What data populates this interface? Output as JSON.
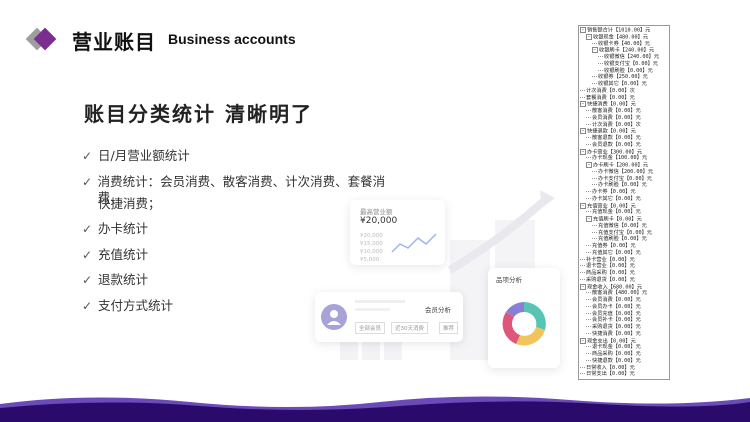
{
  "header": {
    "title_cn": "营业账目",
    "title_en": "Business accounts"
  },
  "headline": "账目分类统计  清晰明了",
  "features": [
    "日/月营业额统计",
    "消费统计：会员消费、散客消费、计次消费、套餐消费、",
    "快捷消费；",
    "办卡统计",
    "充值统计",
    "退款统计",
    "支付方式统计"
  ],
  "illustration": {
    "revenue_card_title": "最高营业额",
    "revenue_value": "¥20,000",
    "product_card_title": "品项分析",
    "member_card_title": "会员分析",
    "member_filters": [
      "全部会员",
      "近30天消费",
      "推荐"
    ],
    "axis_labels": [
      "¥20,000",
      "¥15,000",
      "¥10,000",
      "¥5,000"
    ]
  },
  "tree": [
    {
      "level": 0,
      "toggle": "−",
      "text": "销售额合计【1010.00】元"
    },
    {
      "level": 1,
      "toggle": "−",
      "text": "收银现金【480.00】元"
    },
    {
      "level": 2,
      "toggle": "",
      "text": "收银卡券【40.00】元"
    },
    {
      "level": 2,
      "toggle": "−",
      "text": "收银刷卡【240.00】元"
    },
    {
      "level": 3,
      "toggle": "",
      "text": "收银微信【240.00】元"
    },
    {
      "level": 3,
      "toggle": "",
      "text": "收银支付宝【0.00】元"
    },
    {
      "level": 3,
      "toggle": "",
      "text": "收银刷脸【0.00】元"
    },
    {
      "level": 2,
      "toggle": "",
      "text": "收银券【250.00】元"
    },
    {
      "level": 2,
      "toggle": "",
      "text": "收银其它【0.00】元"
    },
    {
      "level": 0,
      "toggle": "",
      "text": "计次消费【0.00】次"
    },
    {
      "level": 0,
      "toggle": "",
      "text": "套餐消费【0.00】元"
    },
    {
      "level": 0,
      "toggle": "−",
      "text": "快捷消费【0.00】元"
    },
    {
      "level": 1,
      "toggle": "",
      "text": "散客消费【0.00】元"
    },
    {
      "level": 1,
      "toggle": "",
      "text": "会员消费【0.00】元"
    },
    {
      "level": 1,
      "toggle": "",
      "text": "计次消费【0.00】次"
    },
    {
      "level": 0,
      "toggle": "−",
      "text": "快捷退款【0.00】元"
    },
    {
      "level": 1,
      "toggle": "",
      "text": "散客退款【0.00】元"
    },
    {
      "level": 1,
      "toggle": "",
      "text": "会员退款【0.00】元"
    },
    {
      "level": 0,
      "toggle": "−",
      "text": "办卡营业【300.00】元"
    },
    {
      "level": 1,
      "toggle": "",
      "text": "办卡现金【100.00】元"
    },
    {
      "level": 1,
      "toggle": "−",
      "text": "办卡刷卡【200.00】元"
    },
    {
      "level": 2,
      "toggle": "",
      "text": "办卡微信【200.00】元"
    },
    {
      "level": 2,
      "toggle": "",
      "text": "办卡支付宝【0.00】元"
    },
    {
      "level": 2,
      "toggle": "",
      "text": "办卡刷脸【0.00】元"
    },
    {
      "level": 1,
      "toggle": "",
      "text": "办卡券【0.00】元"
    },
    {
      "level": 1,
      "toggle": "",
      "text": "办卡其它【0.00】元"
    },
    {
      "level": 0,
      "toggle": "−",
      "text": "充值营业【0.00】元"
    },
    {
      "level": 1,
      "toggle": "",
      "text": "充值现金【0.00】元"
    },
    {
      "level": 1,
      "toggle": "−",
      "text": "充值刷卡【0.00】元"
    },
    {
      "level": 2,
      "toggle": "",
      "text": "充值微信【0.00】元"
    },
    {
      "level": 2,
      "toggle": "",
      "text": "充值支付宝【0.00】元"
    },
    {
      "level": 2,
      "toggle": "",
      "text": "充值刷脸【0.00】元"
    },
    {
      "level": 1,
      "toggle": "",
      "text": "充值券【0.00】元"
    },
    {
      "level": 1,
      "toggle": "",
      "text": "充值其它【0.00】元"
    },
    {
      "level": 0,
      "toggle": "",
      "text": "补卡营业【0.00】元"
    },
    {
      "level": 0,
      "toggle": "",
      "text": "退卡营业【0.00】元"
    },
    {
      "level": 0,
      "toggle": "",
      "text": "商品采购【0.00】元"
    },
    {
      "level": 0,
      "toggle": "",
      "text": "采购退货【0.00】元"
    },
    {
      "level": 0,
      "toggle": "−",
      "text": "现金收入【680.00】元"
    },
    {
      "level": 1,
      "toggle": "",
      "text": "散客消费【480.00】元"
    },
    {
      "level": 1,
      "toggle": "",
      "text": "会员消费【0.00】元"
    },
    {
      "level": 1,
      "toggle": "",
      "text": "会员办卡【0.00】元"
    },
    {
      "level": 1,
      "toggle": "",
      "text": "会员充值【0.00】元"
    },
    {
      "level": 1,
      "toggle": "",
      "text": "会员补卡【0.00】元"
    },
    {
      "level": 1,
      "toggle": "",
      "text": "采购退货【0.00】元"
    },
    {
      "level": 1,
      "toggle": "",
      "text": "快捷消费【0.00】元"
    },
    {
      "level": 0,
      "toggle": "−",
      "text": "现金支出【0.00】元"
    },
    {
      "level": 1,
      "toggle": "",
      "text": "退卡现金【0.00】元"
    },
    {
      "level": 1,
      "toggle": "",
      "text": "商品采购【0.00】元"
    },
    {
      "level": 1,
      "toggle": "",
      "text": "快捷退款【0.00】元"
    },
    {
      "level": 0,
      "toggle": "",
      "text": "日常收入【0.00】元"
    },
    {
      "level": 0,
      "toggle": "",
      "text": "日常支出【0.00】元"
    }
  ],
  "colors": {
    "logo_purple": "#7b2e8e",
    "logo_gray": "#9e9e9e",
    "wave_dark": "#2a0a6b",
    "wave_light": "#6a4bb8",
    "donut": [
      "#e0557a",
      "#f2c55c",
      "#58c4b3",
      "#8a7fd6"
    ]
  }
}
